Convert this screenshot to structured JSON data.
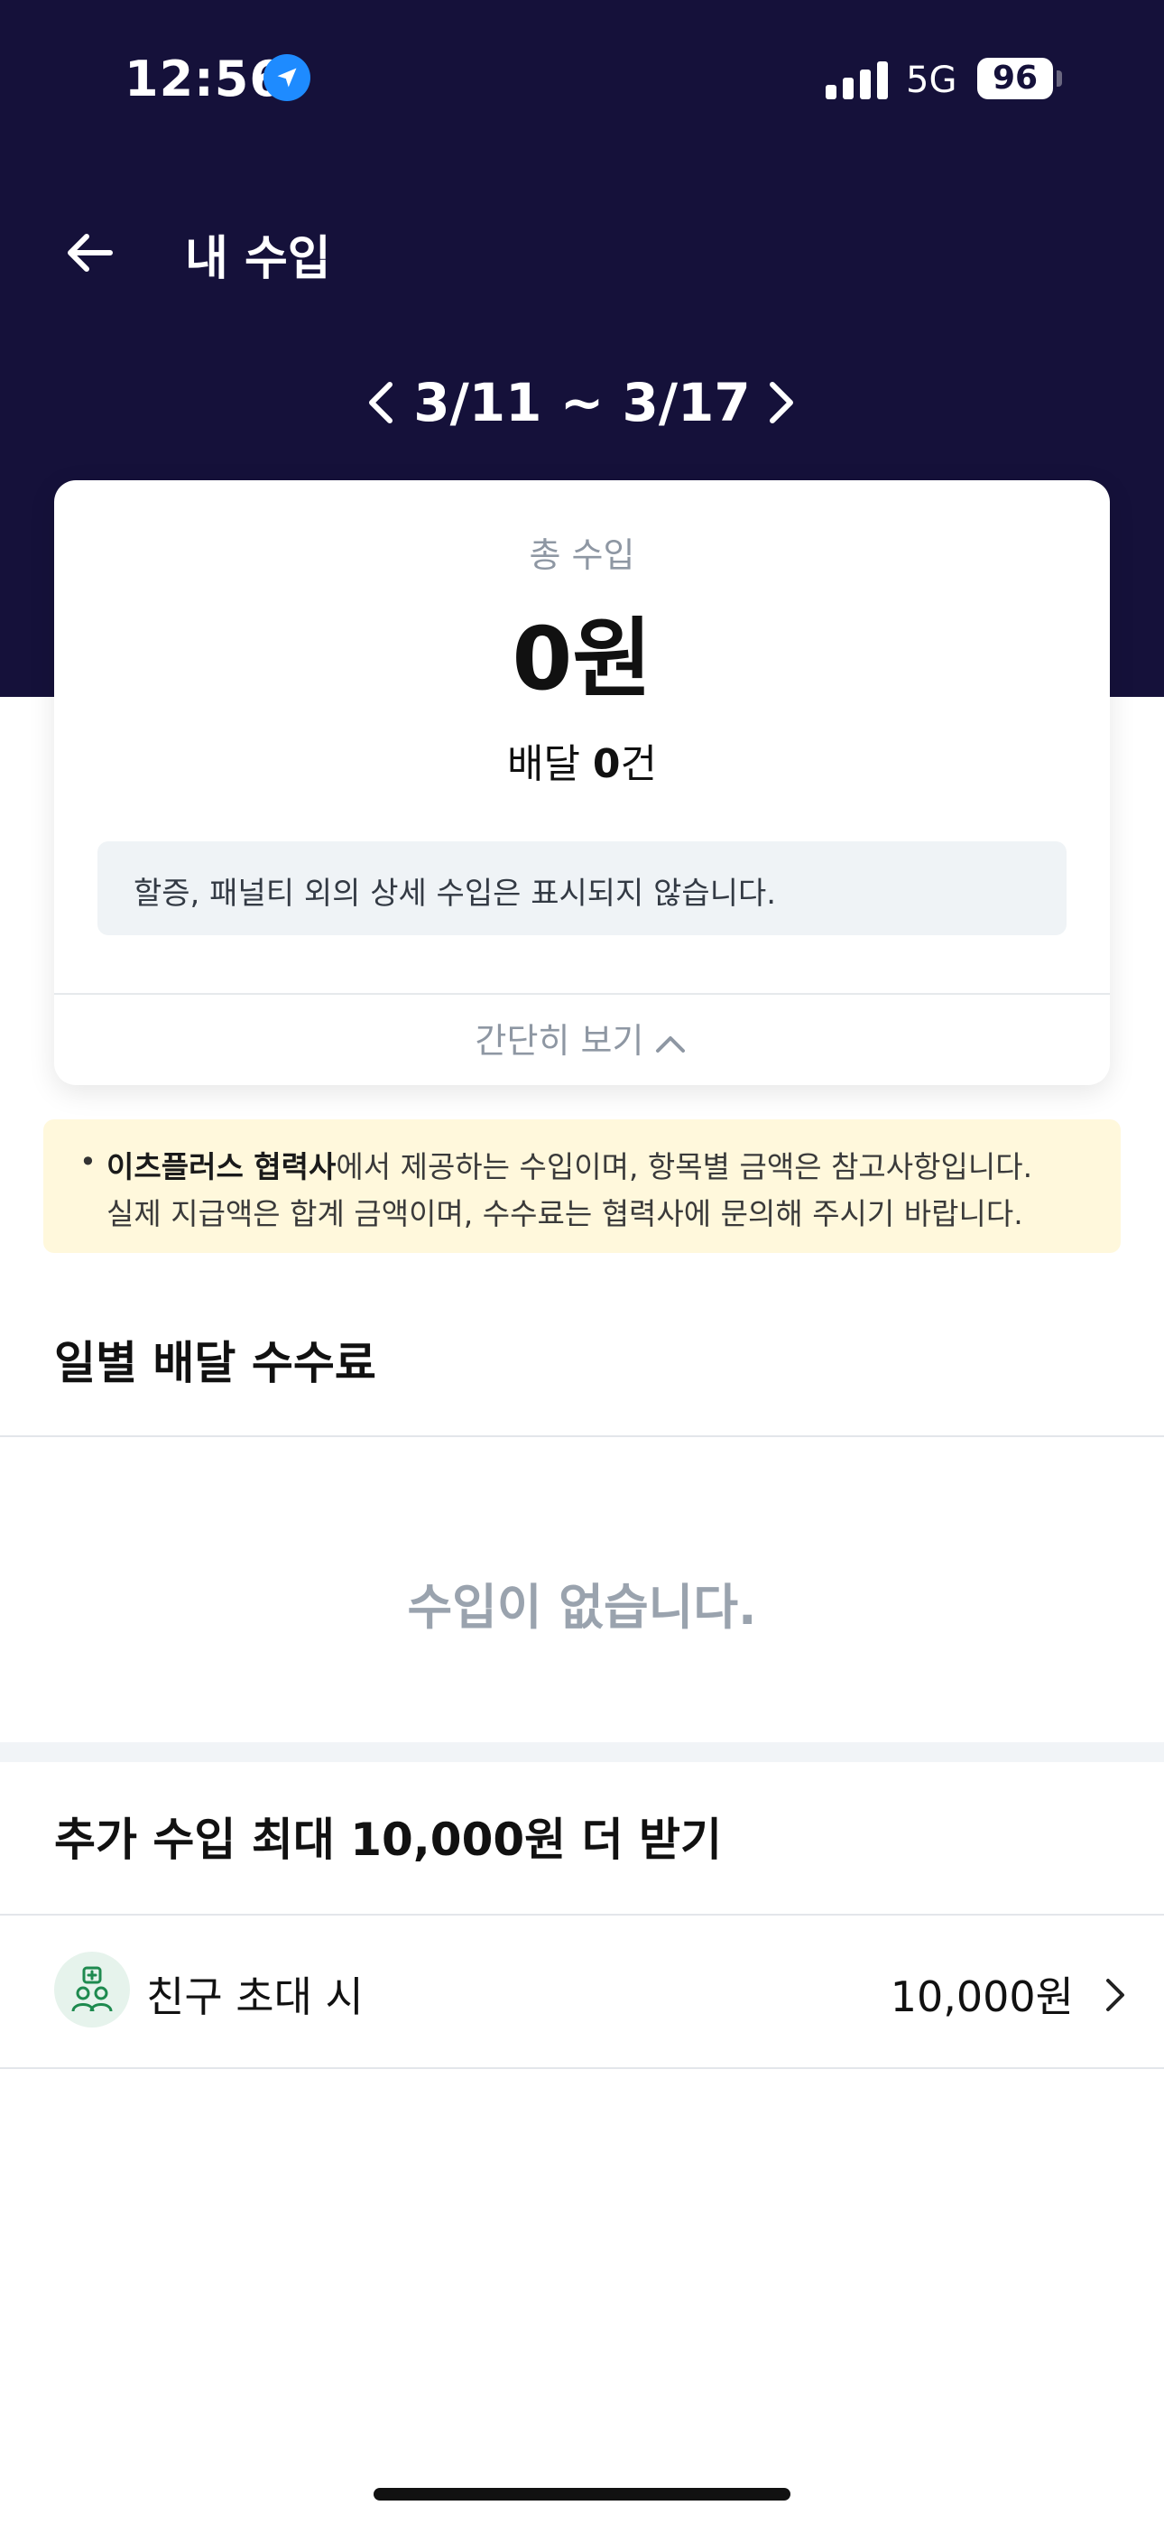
{
  "status_bar": {
    "time": "12:56",
    "network": "5G",
    "battery": "96"
  },
  "header": {
    "title": "내 수입"
  },
  "week": {
    "range": "3/11 ~ 3/17"
  },
  "summary": {
    "total_label": "총 수입",
    "total_amount": "0원",
    "delivery_prefix": "배달 ",
    "delivery_count": "0",
    "delivery_suffix": "건",
    "notice": "할증, 패널티 외의 상세 수입은 표시되지 않습니다.",
    "collapse_label": "간단히 보기"
  },
  "info": {
    "partner": "이츠플러스 협력사",
    "line1_rest": "에서 제공하는 수입이며, 항목별 금액은 참고사항입니다.",
    "line2": "실제 지급액은 합계 금액이며, 수수료는 협력사에 문의해 주시기 바랍니다."
  },
  "daily": {
    "title": "일별 배달 수수료",
    "empty": "수입이 없습니다."
  },
  "extra": {
    "title": "추가 수입 최대 10,000원 더 받기",
    "invite_label": "친구 초대 시",
    "invite_amount": "10,000원"
  }
}
